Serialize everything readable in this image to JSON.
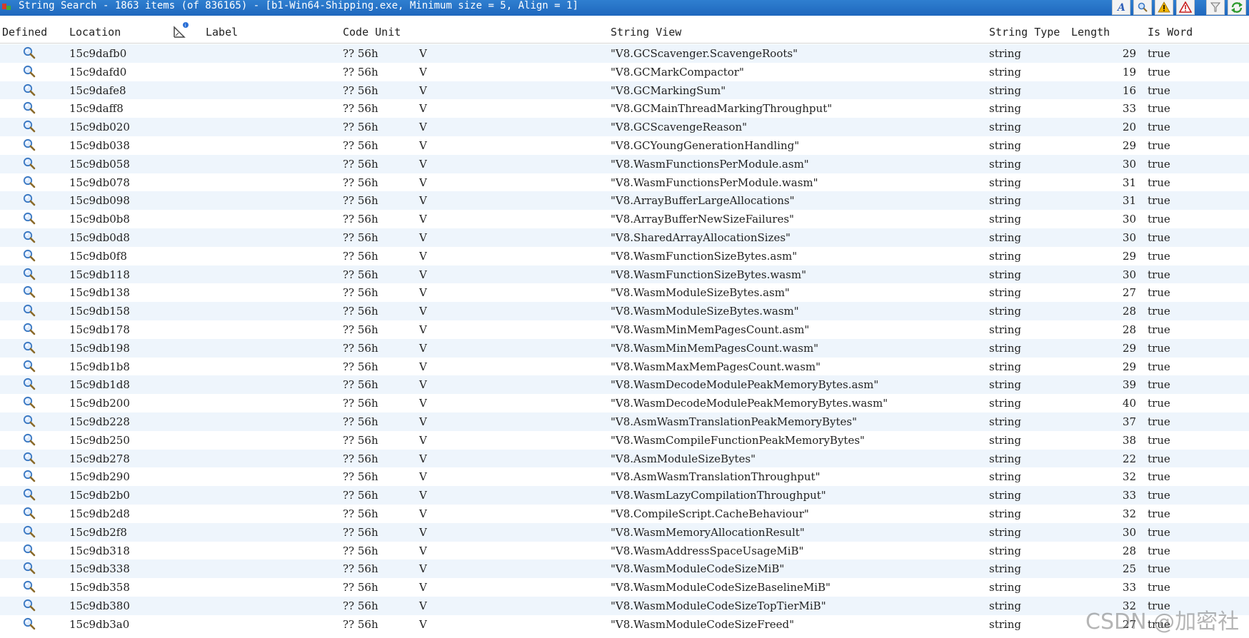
{
  "window": {
    "title": "String Search - 1863 items (of 836165) - [b1-Win64-Shipping.exe, Minimum size = 5, Align = 1]"
  },
  "columns": {
    "defined": "Defined",
    "location": "Location",
    "label": "Label",
    "code_unit": "Code Unit",
    "string_view": "String View",
    "string_type": "String Type",
    "length": "Length",
    "is_word": "Is Word"
  },
  "rows": [
    {
      "loc": "15c9dafb0",
      "cu": "?? 56h",
      "ch": "V",
      "sv": "\"V8.GCScavenger.ScavengeRoots\"",
      "type": "string",
      "len": "29",
      "word": "true"
    },
    {
      "loc": "15c9dafd0",
      "cu": "?? 56h",
      "ch": "V",
      "sv": "\"V8.GCMarkCompactor\"",
      "type": "string",
      "len": "19",
      "word": "true"
    },
    {
      "loc": "15c9dafe8",
      "cu": "?? 56h",
      "ch": "V",
      "sv": "\"V8.GCMarkingSum\"",
      "type": "string",
      "len": "16",
      "word": "true"
    },
    {
      "loc": "15c9daff8",
      "cu": "?? 56h",
      "ch": "V",
      "sv": "\"V8.GCMainThreadMarkingThroughput\"",
      "type": "string",
      "len": "33",
      "word": "true"
    },
    {
      "loc": "15c9db020",
      "cu": "?? 56h",
      "ch": "V",
      "sv": "\"V8.GCScavengeReason\"",
      "type": "string",
      "len": "20",
      "word": "true"
    },
    {
      "loc": "15c9db038",
      "cu": "?? 56h",
      "ch": "V",
      "sv": "\"V8.GCYoungGenerationHandling\"",
      "type": "string",
      "len": "29",
      "word": "true"
    },
    {
      "loc": "15c9db058",
      "cu": "?? 56h",
      "ch": "V",
      "sv": "\"V8.WasmFunctionsPerModule.asm\"",
      "type": "string",
      "len": "30",
      "word": "true"
    },
    {
      "loc": "15c9db078",
      "cu": "?? 56h",
      "ch": "V",
      "sv": "\"V8.WasmFunctionsPerModule.wasm\"",
      "type": "string",
      "len": "31",
      "word": "true"
    },
    {
      "loc": "15c9db098",
      "cu": "?? 56h",
      "ch": "V",
      "sv": "\"V8.ArrayBufferLargeAllocations\"",
      "type": "string",
      "len": "31",
      "word": "true"
    },
    {
      "loc": "15c9db0b8",
      "cu": "?? 56h",
      "ch": "V",
      "sv": "\"V8.ArrayBufferNewSizeFailures\"",
      "type": "string",
      "len": "30",
      "word": "true"
    },
    {
      "loc": "15c9db0d8",
      "cu": "?? 56h",
      "ch": "V",
      "sv": "\"V8.SharedArrayAllocationSizes\"",
      "type": "string",
      "len": "30",
      "word": "true"
    },
    {
      "loc": "15c9db0f8",
      "cu": "?? 56h",
      "ch": "V",
      "sv": "\"V8.WasmFunctionSizeBytes.asm\"",
      "type": "string",
      "len": "29",
      "word": "true"
    },
    {
      "loc": "15c9db118",
      "cu": "?? 56h",
      "ch": "V",
      "sv": "\"V8.WasmFunctionSizeBytes.wasm\"",
      "type": "string",
      "len": "30",
      "word": "true"
    },
    {
      "loc": "15c9db138",
      "cu": "?? 56h",
      "ch": "V",
      "sv": "\"V8.WasmModuleSizeBytes.asm\"",
      "type": "string",
      "len": "27",
      "word": "true"
    },
    {
      "loc": "15c9db158",
      "cu": "?? 56h",
      "ch": "V",
      "sv": "\"V8.WasmModuleSizeBytes.wasm\"",
      "type": "string",
      "len": "28",
      "word": "true"
    },
    {
      "loc": "15c9db178",
      "cu": "?? 56h",
      "ch": "V",
      "sv": "\"V8.WasmMinMemPagesCount.asm\"",
      "type": "string",
      "len": "28",
      "word": "true"
    },
    {
      "loc": "15c9db198",
      "cu": "?? 56h",
      "ch": "V",
      "sv": "\"V8.WasmMinMemPagesCount.wasm\"",
      "type": "string",
      "len": "29",
      "word": "true"
    },
    {
      "loc": "15c9db1b8",
      "cu": "?? 56h",
      "ch": "V",
      "sv": "\"V8.WasmMaxMemPagesCount.wasm\"",
      "type": "string",
      "len": "29",
      "word": "true"
    },
    {
      "loc": "15c9db1d8",
      "cu": "?? 56h",
      "ch": "V",
      "sv": "\"V8.WasmDecodeModulePeakMemoryBytes.asm\"",
      "type": "string",
      "len": "39",
      "word": "true"
    },
    {
      "loc": "15c9db200",
      "cu": "?? 56h",
      "ch": "V",
      "sv": "\"V8.WasmDecodeModulePeakMemoryBytes.wasm\"",
      "type": "string",
      "len": "40",
      "word": "true"
    },
    {
      "loc": "15c9db228",
      "cu": "?? 56h",
      "ch": "V",
      "sv": "\"V8.AsmWasmTranslationPeakMemoryBytes\"",
      "type": "string",
      "len": "37",
      "word": "true"
    },
    {
      "loc": "15c9db250",
      "cu": "?? 56h",
      "ch": "V",
      "sv": "\"V8.WasmCompileFunctionPeakMemoryBytes\"",
      "type": "string",
      "len": "38",
      "word": "true"
    },
    {
      "loc": "15c9db278",
      "cu": "?? 56h",
      "ch": "V",
      "sv": "\"V8.AsmModuleSizeBytes\"",
      "type": "string",
      "len": "22",
      "word": "true"
    },
    {
      "loc": "15c9db290",
      "cu": "?? 56h",
      "ch": "V",
      "sv": "\"V8.AsmWasmTranslationThroughput\"",
      "type": "string",
      "len": "32",
      "word": "true"
    },
    {
      "loc": "15c9db2b0",
      "cu": "?? 56h",
      "ch": "V",
      "sv": "\"V8.WasmLazyCompilationThroughput\"",
      "type": "string",
      "len": "33",
      "word": "true"
    },
    {
      "loc": "15c9db2d8",
      "cu": "?? 56h",
      "ch": "V",
      "sv": "\"V8.CompileScript.CacheBehaviour\"",
      "type": "string",
      "len": "32",
      "word": "true"
    },
    {
      "loc": "15c9db2f8",
      "cu": "?? 56h",
      "ch": "V",
      "sv": "\"V8.WasmMemoryAllocationResult\"",
      "type": "string",
      "len": "30",
      "word": "true"
    },
    {
      "loc": "15c9db318",
      "cu": "?? 56h",
      "ch": "V",
      "sv": "\"V8.WasmAddressSpaceUsageMiB\"",
      "type": "string",
      "len": "28",
      "word": "true"
    },
    {
      "loc": "15c9db338",
      "cu": "?? 56h",
      "ch": "V",
      "sv": "\"V8.WasmModuleCodeSizeMiB\"",
      "type": "string",
      "len": "25",
      "word": "true"
    },
    {
      "loc": "15c9db358",
      "cu": "?? 56h",
      "ch": "V",
      "sv": "\"V8.WasmModuleCodeSizeBaselineMiB\"",
      "type": "string",
      "len": "33",
      "word": "true"
    },
    {
      "loc": "15c9db380",
      "cu": "?? 56h",
      "ch": "V",
      "sv": "\"V8.WasmModuleCodeSizeTopTierMiB\"",
      "type": "string",
      "len": "32",
      "word": "true"
    },
    {
      "loc": "15c9db3a0",
      "cu": "?? 56h",
      "ch": "V",
      "sv": "\"V8.WasmModuleCodeSizeFreed\"",
      "type": "string",
      "len": "27",
      "word": "true"
    }
  ],
  "watermark": "CSDN @加密社",
  "colors": {
    "titlebar": "#1f67bd",
    "row_alt": "#eef5fc",
    "magnifier": "#3a78c2"
  }
}
